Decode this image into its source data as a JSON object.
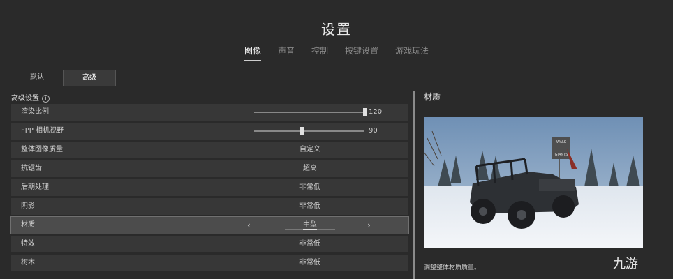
{
  "header": {
    "title": "设置"
  },
  "main_tabs": [
    "图像",
    "声音",
    "控制",
    "按键设置",
    "游戏玩法"
  ],
  "sub_tabs": [
    "默认",
    "高级"
  ],
  "section": {
    "title": "高级设置"
  },
  "settings": [
    {
      "label": "渲染比例",
      "slider_value": "120",
      "slider_fraction": 1.0
    },
    {
      "label": "FPP 相机视野",
      "slider_value": "90",
      "slider_fraction": 0.43
    },
    {
      "label": "整体图像质量",
      "value": "自定义"
    },
    {
      "label": "抗锯齿",
      "value": "超高"
    },
    {
      "label": "后期处理",
      "value": "非常低"
    },
    {
      "label": "阴影",
      "value": "非常低"
    },
    {
      "label": "材质",
      "value": "中型",
      "left_arrow": "‹",
      "right_arrow": "›"
    },
    {
      "label": "特效",
      "value": "非常低"
    },
    {
      "label": "树木",
      "value": "非常低"
    }
  ],
  "detail": {
    "title": "材质",
    "description": "调整整体材质质量。",
    "sign_text": [
      "WALK",
      "GIANTS"
    ]
  },
  "watermark": {
    "text": "九游"
  }
}
